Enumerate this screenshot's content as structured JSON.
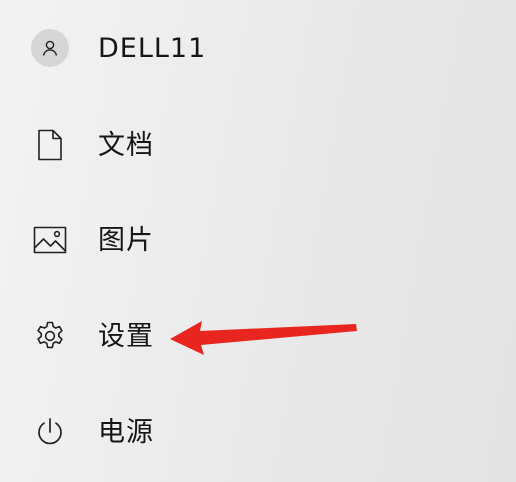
{
  "start_menu": {
    "items": [
      {
        "id": "user",
        "label": "DELL11",
        "icon": "user-avatar-icon"
      },
      {
        "id": "documents",
        "label": "文档",
        "icon": "document-icon"
      },
      {
        "id": "pictures",
        "label": "图片",
        "icon": "picture-icon"
      },
      {
        "id": "settings",
        "label": "设置",
        "icon": "gear-icon"
      },
      {
        "id": "power",
        "label": "电源",
        "icon": "power-icon"
      }
    ]
  },
  "annotation": {
    "arrow_color": "#e8261f",
    "points_to": "settings"
  }
}
